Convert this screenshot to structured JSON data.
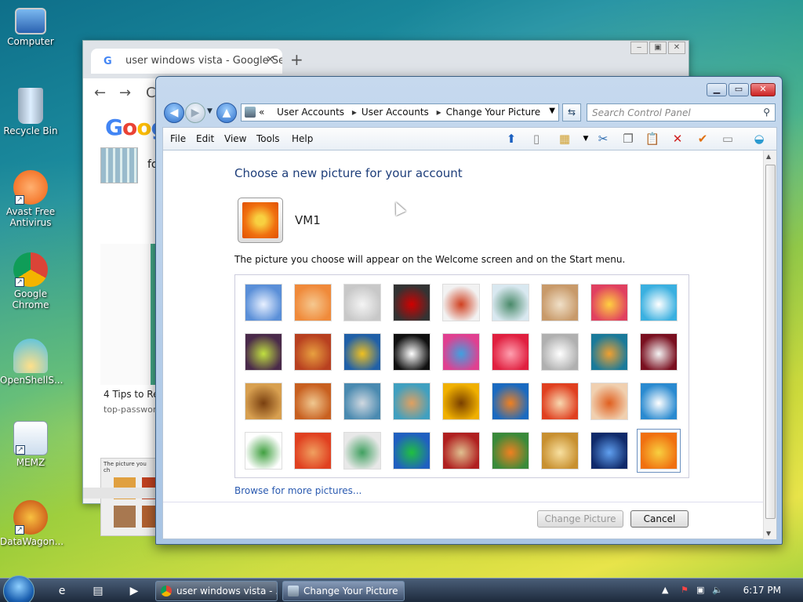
{
  "desktop": {
    "icons": [
      {
        "label": "Computer"
      },
      {
        "label": "Recycle Bin"
      },
      {
        "label": "Avast Free Antivirus"
      },
      {
        "label": "Google Chrome"
      },
      {
        "label": "OpenShellS..."
      },
      {
        "label": "MEMZ"
      },
      {
        "label": "DataWagon..."
      }
    ]
  },
  "chrome": {
    "tab_title": "user windows vista - Google Sear",
    "tab_close": "✕",
    "new_tab": "+",
    "logo": "Goog",
    "search_fragment": "fo",
    "result_title": "4 Tips to Re",
    "result_source": "top-passwor",
    "shot_caption": "The picture you ch"
  },
  "window": {
    "breadcrumb": [
      "User Accounts",
      "User Accounts",
      "Change Your Picture"
    ],
    "breadcrumb_prefix": "«",
    "search_placeholder": "Search Control Panel",
    "menu": [
      "File",
      "Edit",
      "View",
      "Tools",
      "Help"
    ],
    "heading": "Choose a new picture for your account",
    "username": "VM1",
    "description": "The picture you choose will appear on the Welcome screen and on the Start menu.",
    "browse_link": "Browse for more pictures...",
    "change_button": "Change Picture",
    "cancel_button": "Cancel",
    "selected_picture_index": 35
  },
  "pictures": [
    {
      "name": "roller-coaster",
      "c1": "#5a8fd8",
      "c2": "#e8f0ff"
    },
    {
      "name": "starfish",
      "c1": "#f08a3a",
      "c2": "#f5c890"
    },
    {
      "name": "robot-toy",
      "c1": "#c8c8c8",
      "c2": "#f4f4f4"
    },
    {
      "name": "record-player",
      "c1": "#333333",
      "c2": "#d00000"
    },
    {
      "name": "lucky-cat",
      "c1": "#f2f2f2",
      "c2": "#d04020"
    },
    {
      "name": "gyroscope",
      "c1": "#d9e8f0",
      "c2": "#4a8a6a"
    },
    {
      "name": "kitten",
      "c1": "#c89a6a",
      "c2": "#f0e0c8"
    },
    {
      "name": "flower-pink",
      "c1": "#e04060",
      "c2": "#ffd040"
    },
    {
      "name": "pinwheel",
      "c1": "#3ab0e0",
      "c2": "#ffffff"
    },
    {
      "name": "ball-striped",
      "c1": "#4a2a4a",
      "c2": "#c0e040"
    },
    {
      "name": "fabric-stripes",
      "c1": "#b84020",
      "c2": "#e8a040"
    },
    {
      "name": "leaf-yellow",
      "c1": "#2060a8",
      "c2": "#f0c020"
    },
    {
      "name": "dog-border-collie",
      "c1": "#111111",
      "c2": "#ffffff"
    },
    {
      "name": "crayons",
      "c1": "#e04090",
      "c2": "#40a0e0"
    },
    {
      "name": "paper-star",
      "c1": "#e02040",
      "c2": "#ffa0b0"
    },
    {
      "name": "jacks",
      "c1": "#b0b0b0",
      "c2": "#ffffff"
    },
    {
      "name": "stairs",
      "c1": "#1a7a9a",
      "c2": "#f0a030"
    },
    {
      "name": "origami-crane",
      "c1": "#7a1020",
      "c2": "#f4f4f4"
    },
    {
      "name": "guitar",
      "c1": "#d8a050",
      "c2": "#7a4010"
    },
    {
      "name": "pomeranian",
      "c1": "#c86020",
      "c2": "#f0c890"
    },
    {
      "name": "tin-robot",
      "c1": "#4a8ab0",
      "c2": "#d0d8e0"
    },
    {
      "name": "fabric-drape",
      "c1": "#40a0c0",
      "c2": "#e0a060"
    },
    {
      "name": "sunflower",
      "c1": "#f0b000",
      "c2": "#7a4000"
    },
    {
      "name": "fish",
      "c1": "#1a6ac0",
      "c2": "#f08020"
    },
    {
      "name": "hot-air-balloon",
      "c1": "#e04020",
      "c2": "#f8d8b0"
    },
    {
      "name": "doll",
      "c1": "#f0d0b0",
      "c2": "#e06020"
    },
    {
      "name": "sailboat",
      "c1": "#2a8ad0",
      "c2": "#ffffff"
    },
    {
      "name": "soccer-ball",
      "c1": "#ffffff",
      "c2": "#40a040"
    },
    {
      "name": "fabric-red",
      "c1": "#e04020",
      "c2": "#f0a060"
    },
    {
      "name": "marbles",
      "c1": "#e8e8e8",
      "c2": "#40a060"
    },
    {
      "name": "window-green",
      "c1": "#2060c0",
      "c2": "#20c040"
    },
    {
      "name": "textile-pattern",
      "c1": "#b02020",
      "c2": "#e0c090"
    },
    {
      "name": "butterfly",
      "c1": "#3a8a3a",
      "c2": "#f08020"
    },
    {
      "name": "shell-spiral",
      "c1": "#c89030",
      "c2": "#f8e0a0"
    },
    {
      "name": "lighthouse",
      "c1": "#102a6a",
      "c2": "#60a0f0"
    },
    {
      "name": "daisy-orange",
      "c1": "#f07010",
      "c2": "#f8d040"
    }
  ],
  "taskbar": {
    "tasks": [
      "user windows vista - ...",
      "Change Your Picture"
    ],
    "clock": "6:17 PM"
  }
}
